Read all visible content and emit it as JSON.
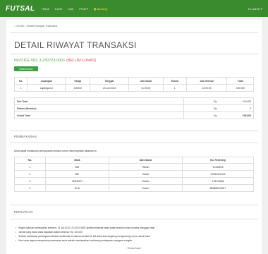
{
  "nav": {
    "brand": "FUTSAL",
    "links": [
      "Home",
      "Event",
      "Club",
      "Profil ▾"
    ],
    "booking": "Booking",
    "user": "Hi, Admin ▾"
  },
  "breadcrumb": {
    "home": "Home",
    "sep": "/",
    "current": "Detail Riwayat Transaksi"
  },
  "page_title": "DETAIL RIWAYAT TRANSAKSI",
  "invoice": {
    "label": "INVOICE NO. J-230723-0001",
    "status": "(BELUM LUNAS)"
  },
  "status_button": "Detail Invoice",
  "detail_table": {
    "headers": [
      "No.",
      "Lapangan",
      "Harga",
      "Tanggal",
      "Jam Mulai",
      "Durasi",
      "Jam Selesai",
      "Total"
    ],
    "rows": [
      [
        "1",
        "Lapangan A",
        "100000",
        "24 Juli 2023",
        "11:00:00",
        "1",
        "12:00:00",
        "100,000"
      ]
    ]
  },
  "summary": [
    {
      "label": "Sub Total",
      "currency": "Rp",
      "value": "100,000"
    },
    {
      "label": "Diskon (Member)",
      "currency": "Rp",
      "value": "0"
    },
    {
      "label": "Grand Total",
      "currency": "Rp",
      "value": "100,000"
    }
  ],
  "payment": {
    "title": "PEMBAYARAN",
    "note": "Anda dapat melakukan pembayaran melalui nomor rekening/bank dibawah ini.",
    "headers": [
      "No.",
      "Bank",
      "Atas Nama",
      "No. Rekening"
    ],
    "rows": [
      [
        "1",
        "BNI",
        "Harlan",
        "12345678"
      ],
      [
        "2",
        "BRI",
        "Harlan",
        "87654321323"
      ],
      [
        "3",
        "MANDIRI",
        "Harlan",
        "178734656"
      ],
      [
        "4",
        "BCA",
        "Harlan",
        "888888342347"
      ]
    ]
  },
  "attention": {
    "title": "PERHATIAN",
    "items": [
      "Segera lakukan pembayaran sebelum: 23 Juli 2023 | 21:02:02 WIB, apabila melewati batas waktu tersebut maka booking dianggap batal.",
      "Jumlah yang harus anda bayarkan adalah sebesar: Rp. 100,000",
      "Setelah melakukan pembayaran lakukan konfirmasi di halaman berikut ini: klik disini atau langsung menghubungi nomor admin kami.",
      "Kami akan segera memproses pemesanan anda setelah mendapatkan konfirmasi pembayaran sesegera mungkin."
    ],
    "closing": "~ Terima Kasih ~"
  }
}
